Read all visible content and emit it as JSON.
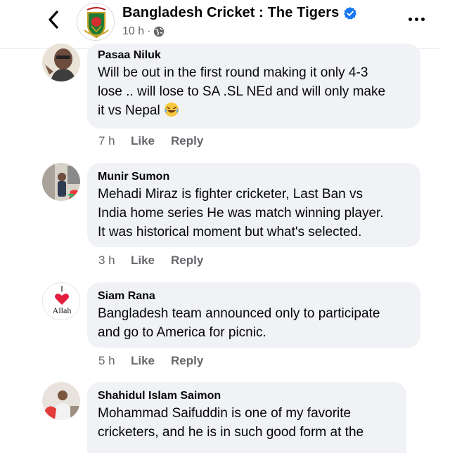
{
  "header": {
    "page_name": "Bangladesh Cricket : The Tigers",
    "time": "10 h",
    "dot": "·"
  },
  "comments": [
    {
      "author": "Pasaa Niluk",
      "text": "Will be out in the first round making it only 4-3\nlose .. will lose to SA .SL NEd and will only make\nit vs Nepal",
      "time": "7 h",
      "like": "Like",
      "reply": "Reply"
    },
    {
      "author": "Munir Sumon",
      "text": "Mehadi Miraz is fighter cricketer, Last Ban vs\nIndia home series He was match winning player.\nIt was historical moment but what's selected.",
      "time": "3 h",
      "like": "Like",
      "reply": "Reply"
    },
    {
      "author": "Siam Rana",
      "text": "Bangladesh team announced only to participate\nand go to America for picnic.",
      "time": "5 h",
      "like": "Like",
      "reply": "Reply",
      "avatar_text_top": "I",
      "avatar_text_bottom": "Allah"
    },
    {
      "author": "Shahidul Islam Saimon",
      "text": "Mohammad Saifuddin is one of my favorite\ncricketers, and he is in such good form at the"
    }
  ],
  "colors": {
    "bubble": "#f0f2f5",
    "secondary_text": "#65676b",
    "verified_blue": "#1877f2",
    "heart_red": "#e41e3f"
  }
}
